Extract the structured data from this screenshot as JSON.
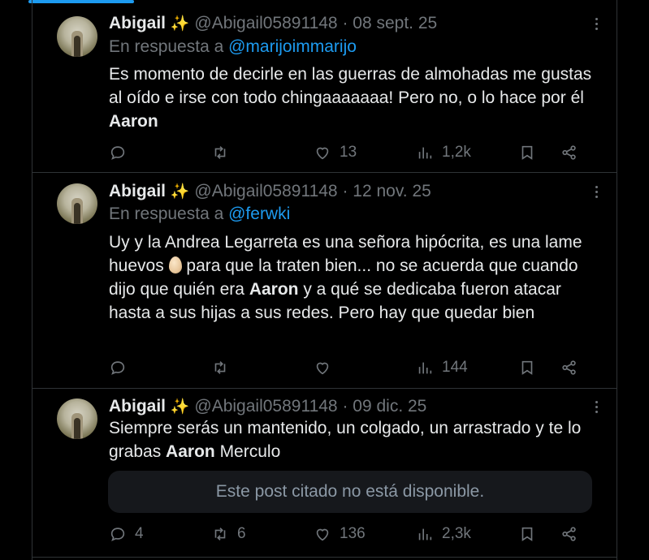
{
  "tweets": [
    {
      "name": "Abigail",
      "emoji": "✨",
      "handle": "@Abigail05891148",
      "sep": "·",
      "date": "08 sept. 25",
      "reply_prefix": "En respuesta a",
      "reply_to": "@marijoimmarijo",
      "text_a": "Es momento de decirle en las guerras de almohadas me gustas al oído e irse con todo chingaaaaaaa! Pero no,  o lo hace por él ",
      "bold": "Aaron",
      "text_b": "",
      "replies": "",
      "retweets": "",
      "likes": "13",
      "views": "1,2k"
    },
    {
      "name": "Abigail",
      "emoji": "✨",
      "handle": "@Abigail05891148",
      "sep": "·",
      "date": "12 nov. 25",
      "reply_prefix": "En respuesta a",
      "reply_to": "@ferwki",
      "text_a": "Uy y la Andrea Legarreta es una señora hipócrita, es una lame huevos ",
      "text_a2": " para que la traten bien... no se acuerda que cuando dijo que quién era ",
      "bold": "Aaron",
      "text_b": " y a qué se dedicaba fueron atacar hasta a sus hijas a sus redes. Pero hay que quedar bien",
      "replies": "",
      "retweets": "",
      "likes": "",
      "views": "144"
    },
    {
      "name": "Abigail",
      "emoji": "✨",
      "handle": "@Abigail05891148",
      "sep": "·",
      "date": "09 dic. 25",
      "text_a": "Siempre serás un mantenido, un colgado, un arrastrado y te lo grabas ",
      "bold": "Aaron",
      "text_b": " Merculo",
      "quote": "Este post citado no está disponible.",
      "replies": "4",
      "retweets": "6",
      "likes": "136",
      "views": "2,3k"
    }
  ],
  "icons": [
    "reply-icon",
    "retweet-icon",
    "like-icon",
    "views-icon",
    "bookmark-icon",
    "share-icon",
    "more-icon"
  ],
  "colors": {
    "background": "#000000",
    "accent": "#1d9bf0",
    "muted": "#71767b",
    "text": "#e7e9ea"
  }
}
